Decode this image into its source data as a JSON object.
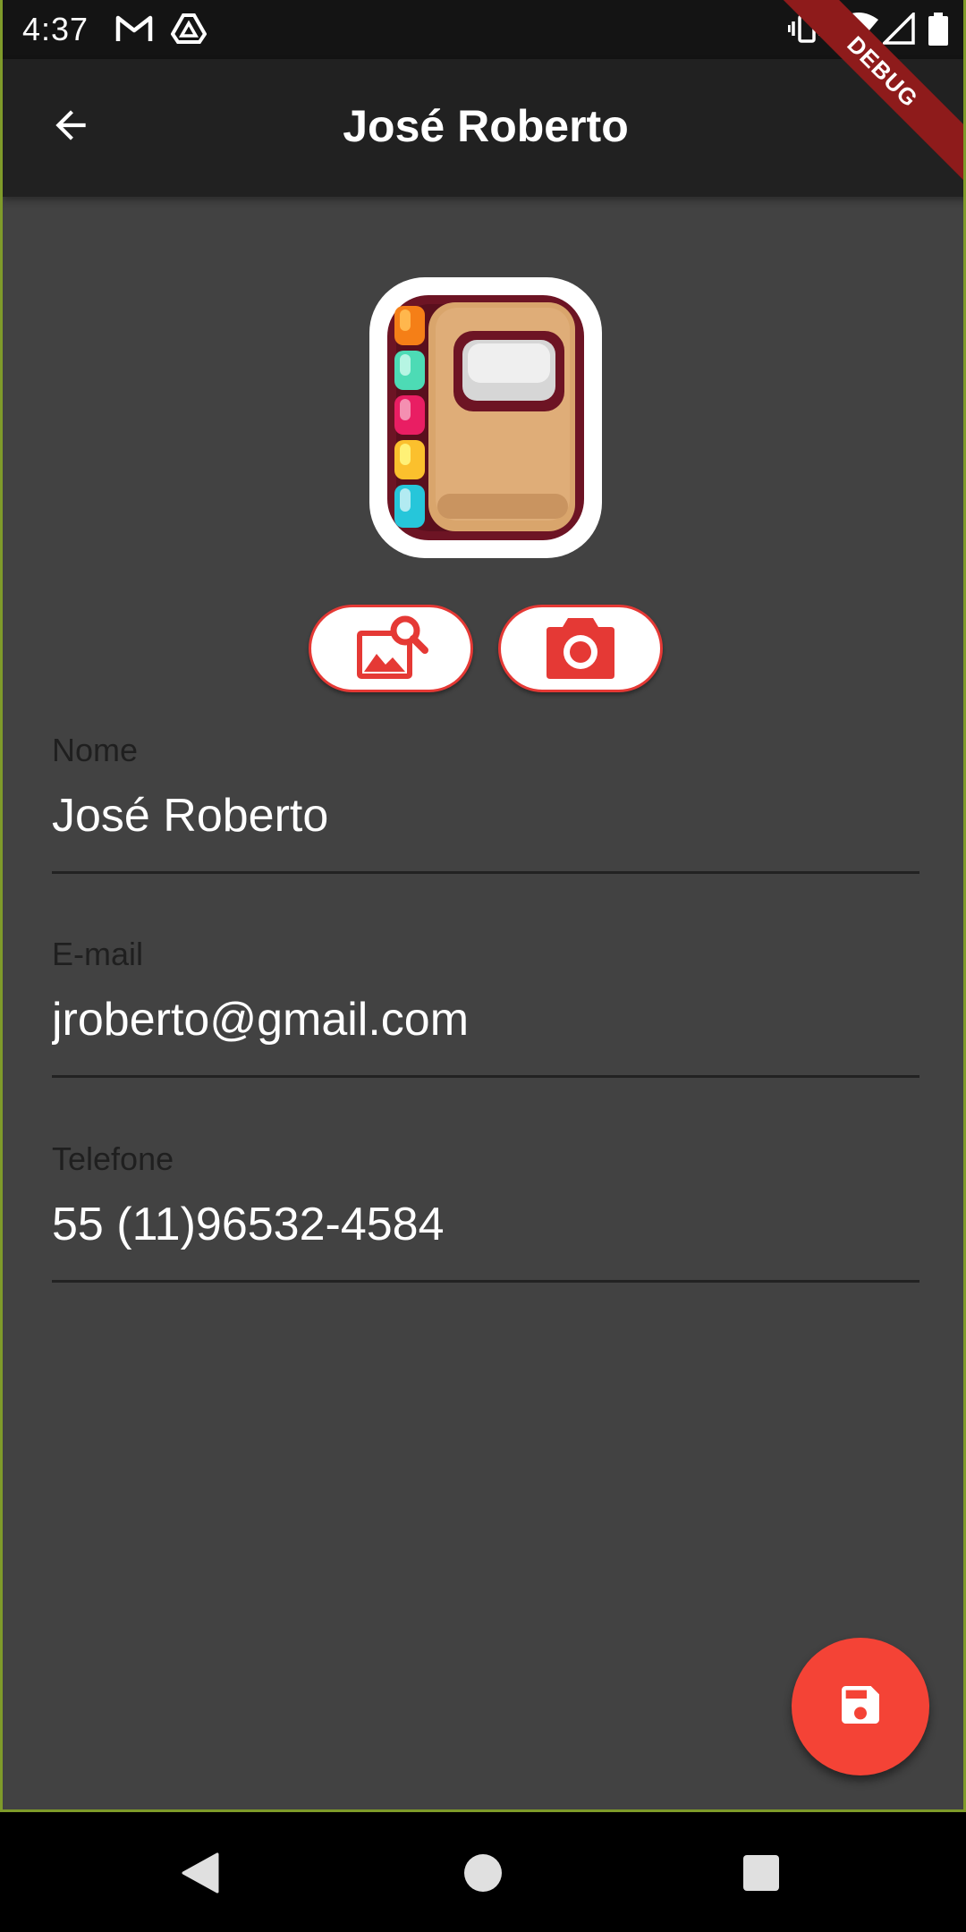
{
  "status_bar": {
    "time": "4:37",
    "icons": [
      "gmail-icon",
      "drive-icon",
      "vibrate-icon",
      "wifi-icon",
      "signal-icon",
      "battery-icon"
    ]
  },
  "debug_banner": {
    "label": "DEBUG"
  },
  "app_bar": {
    "title": "José Roberto",
    "back_icon": "arrow-back-icon"
  },
  "avatar": {
    "icon": "contact-book-icon"
  },
  "image_buttons": {
    "gallery_icon": "image-search-icon",
    "camera_icon": "camera-icon"
  },
  "form": {
    "fields": [
      {
        "label": "Nome",
        "value": "José Roberto"
      },
      {
        "label": "E-mail",
        "value": "jroberto@gmail.com"
      },
      {
        "label": "Telefone",
        "value": "55 (11)96532-4584"
      }
    ]
  },
  "fab": {
    "icon": "save-icon"
  },
  "nav_bar": {
    "icons": [
      "back-triangle-icon",
      "home-circle-icon",
      "recents-square-icon"
    ]
  },
  "colors": {
    "background": "#424242",
    "app_bar": "#212121",
    "accent": "#f44336",
    "debug": "#8e1b1b"
  }
}
